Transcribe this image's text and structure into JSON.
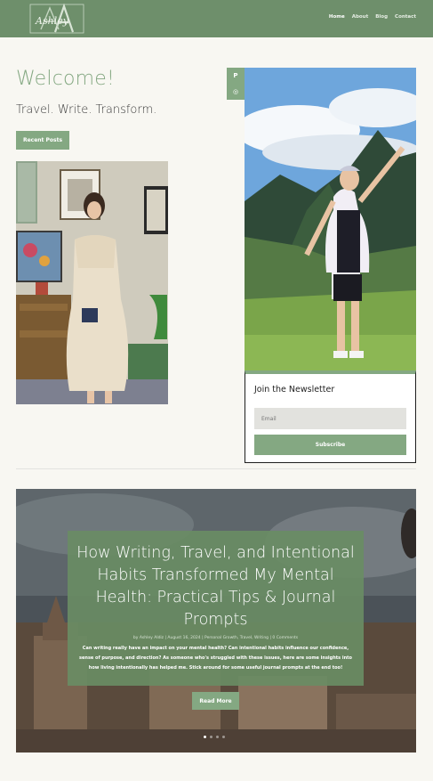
{
  "header": {
    "logo_text": "Ashley",
    "logo_monogram": "AA",
    "nav": [
      "Home",
      "About",
      "Blog",
      "Contact"
    ],
    "active": "Home"
  },
  "hero_intro": {
    "title": "Welcome!",
    "tagline": "Travel. Write. Transform.",
    "recent_button": "Recent Posts"
  },
  "social": {
    "icons": [
      "pinterest-icon",
      "instagram-icon"
    ],
    "pinterest_glyph": "P",
    "instagram_glyph": "◎"
  },
  "newsletter": {
    "title": "Join the Newsletter",
    "email_placeholder": "Email",
    "subscribe_label": "Subscribe"
  },
  "featured_post": {
    "title": "How Writing, Travel, and Intentional Habits Transformed My Mental Health: Practical Tips & Journal Prompts",
    "meta": "by Ashley Aldiz | August 16, 2024 | Personal Growth, Travel, Writing | 0 Comments",
    "excerpt": "Can writing really have an impact on your mental health? Can intentional habits influence our confidence, sense of purpose, and direction? As someone who's struggled with these issues, here are some insights into how living intentionally has helped me. Stick around for some useful journal prompts at the end too!",
    "read_more": "Read More",
    "slides": 4,
    "active_slide": 1
  },
  "colors": {
    "brand_green": "#84a882",
    "header_green": "#6e8f6b",
    "background": "#f8f7f2"
  }
}
